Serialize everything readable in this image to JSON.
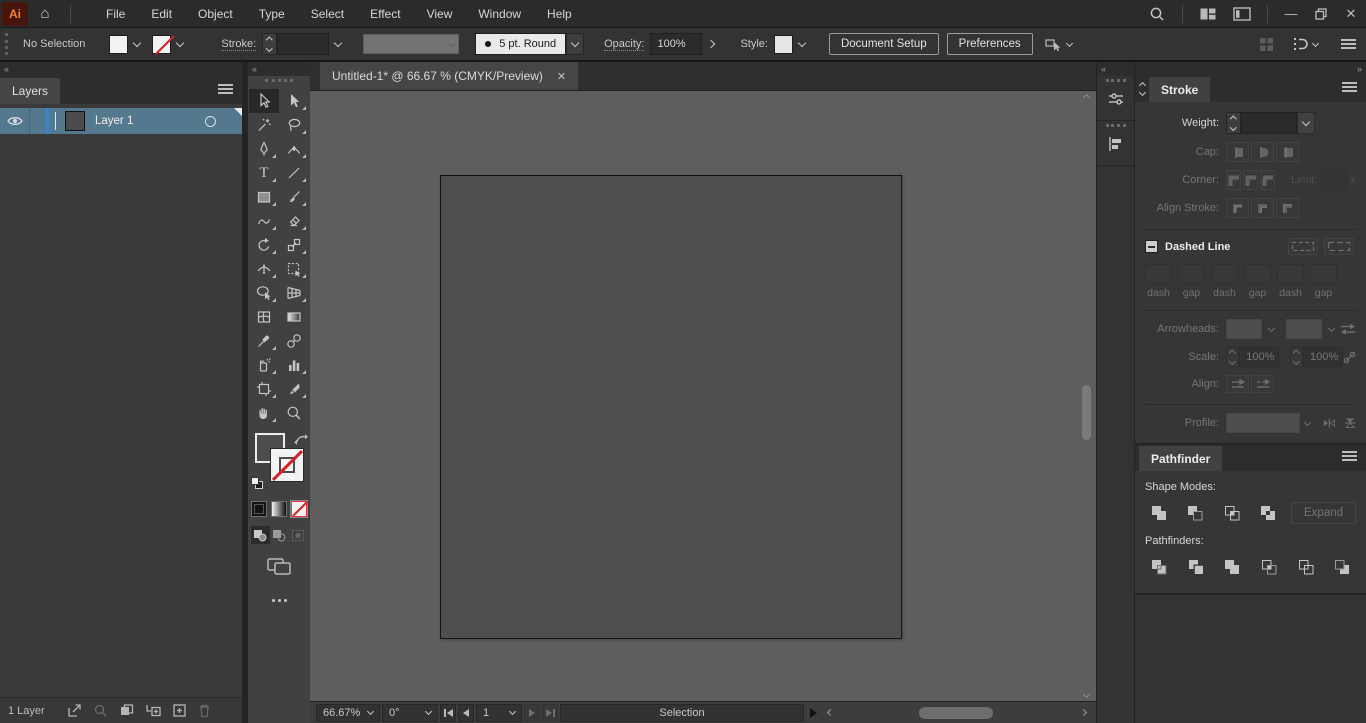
{
  "titlebar": {
    "logo_text": "Ai",
    "menus": [
      "File",
      "Edit",
      "Object",
      "Type",
      "Select",
      "Effect",
      "View",
      "Window",
      "Help"
    ]
  },
  "icons": {
    "close_tab": "✕",
    "collapse_left": "«",
    "collapse_right": "»",
    "minimize": "—",
    "close_window": "✕"
  },
  "control_bar": {
    "no_selection": "No Selection",
    "stroke_label": "Stroke:",
    "brush_name": "5 pt. Round",
    "opacity_label": "Opacity:",
    "opacity_value": "100%",
    "style_label": "Style:",
    "document_setup": "Document Setup",
    "preferences": "Preferences"
  },
  "document": {
    "tab_title": "Untitled-1* @ 66.67 % (CMYK/Preview)"
  },
  "layers_panel": {
    "tab": "Layers",
    "layer_name": "Layer 1",
    "count": "1 Layer"
  },
  "tools": {
    "type_glyph": "T",
    "names": [
      "selection",
      "direct-selection",
      "magic-wand",
      "lasso",
      "pen",
      "curvature",
      "type",
      "line-segment",
      "rectangle",
      "paintbrush",
      "shaper",
      "eraser",
      "rotate",
      "scale",
      "width",
      "free-transform",
      "shape-builder",
      "perspective-grid",
      "mesh",
      "gradient",
      "eyedropper",
      "blend",
      "symbol-sprayer",
      "column-graph",
      "artboard",
      "slice",
      "hand",
      "zoom"
    ]
  },
  "stroke_panel": {
    "tab": "Stroke",
    "weight_label": "Weight:",
    "cap_label": "Cap:",
    "corner_label": "Corner:",
    "limit_label": "Limit:",
    "limit_suffix": "x",
    "align_stroke_label": "Align Stroke:",
    "dashed_line_label": "Dashed Line",
    "dash_labels": [
      "dash",
      "gap",
      "dash",
      "gap",
      "dash",
      "gap"
    ],
    "arrowheads_label": "Arrowheads:",
    "scale_label": "Scale:",
    "scale_value_1": "100%",
    "scale_value_2": "100%",
    "align_label": "Align:",
    "profile_label": "Profile:"
  },
  "pathfinder_panel": {
    "tab": "Pathfinder",
    "shape_modes_label": "Shape Modes:",
    "expand_label": "Expand",
    "pathfinders_label": "Pathfinders:",
    "shape_mode_names": [
      "unite",
      "minus-front",
      "intersect",
      "exclude"
    ],
    "pathfinder_names": [
      "divide",
      "trim",
      "merge",
      "crop",
      "outline",
      "minus-back"
    ]
  },
  "status_bar": {
    "zoom": "66.67%",
    "rotation": "0°",
    "page": "1",
    "tool": "Selection"
  },
  "colors": {
    "logo_bg": "#47150c",
    "logo_text": "#ef8139",
    "accent_blue": "#3d85c6",
    "selected_layer_row": "#54788e",
    "canvas_bg": "#5e5e5e",
    "artboard_fill": "#4f4f4f",
    "none_slash_red": "#d21f26",
    "panel_bg": "#363636"
  }
}
